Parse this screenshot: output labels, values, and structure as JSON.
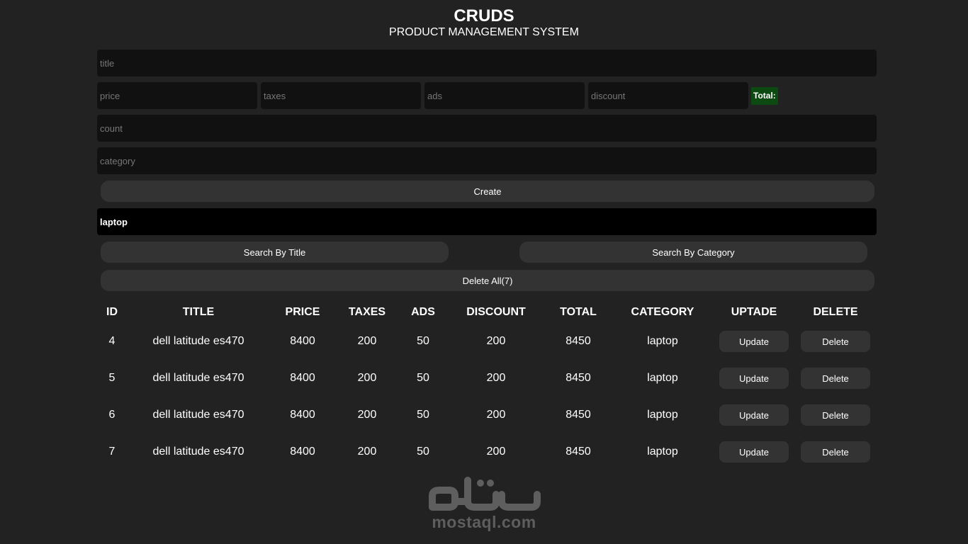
{
  "header": {
    "title": "CRUDS",
    "subtitle": "PRODUCT MANAGEMENT SYSTEM"
  },
  "form": {
    "title_placeholder": "title",
    "price_placeholder": "price",
    "taxes_placeholder": "taxes",
    "ads_placeholder": "ads",
    "discount_placeholder": "discount",
    "total_label": "Total:",
    "count_placeholder": "count",
    "category_placeholder": "category",
    "create_label": "Create"
  },
  "search": {
    "value": "laptop",
    "by_title_label": "Search By Title",
    "by_category_label": "Search By Category",
    "delete_all_label": "Delete All(7)"
  },
  "table": {
    "headers": [
      "ID",
      "TITLE",
      "PRICE",
      "TAXES",
      "ADS",
      "DISCOUNT",
      "TOTAL",
      "CATEGORY",
      "UPTADE",
      "DELETE"
    ],
    "update_label": "Update",
    "delete_label": "Delete",
    "rows": [
      {
        "id": "4",
        "title": "dell latitude es470",
        "price": "8400",
        "taxes": "200",
        "ads": "50",
        "discount": "200",
        "total": "8450",
        "category": "laptop"
      },
      {
        "id": "5",
        "title": "dell latitude es470",
        "price": "8400",
        "taxes": "200",
        "ads": "50",
        "discount": "200",
        "total": "8450",
        "category": "laptop"
      },
      {
        "id": "6",
        "title": "dell latitude es470",
        "price": "8400",
        "taxes": "200",
        "ads": "50",
        "discount": "200",
        "total": "8450",
        "category": "laptop"
      },
      {
        "id": "7",
        "title": "dell latitude es470",
        "price": "8400",
        "taxes": "200",
        "ads": "50",
        "discount": "200",
        "total": "8450",
        "category": "laptop"
      }
    ]
  },
  "watermark": {
    "icon": "mostaql-logo-icon",
    "text": "mostaql.com",
    "color": "#5e5e5e"
  },
  "colors": {
    "background": "#222222",
    "input": "#111111",
    "search_input": "#000000",
    "button": "#333333",
    "total_badge": "#0c4a12"
  }
}
